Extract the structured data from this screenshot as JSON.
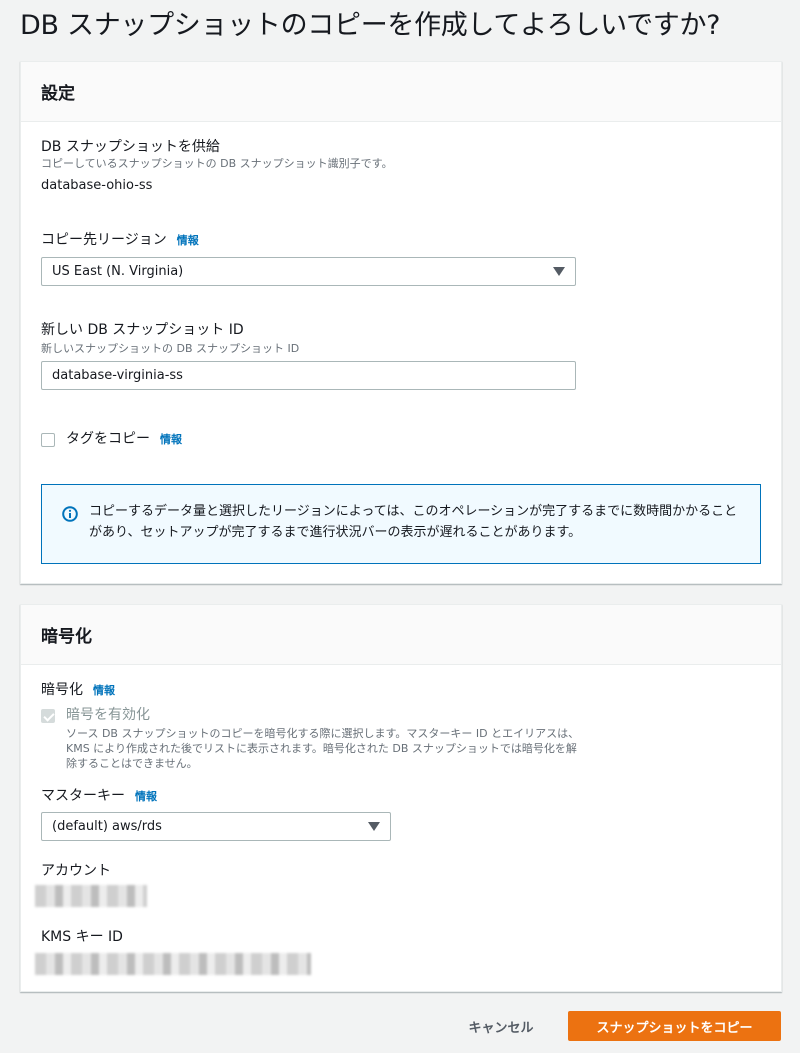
{
  "page": {
    "title": "DB スナップショットのコピーを作成してよろしいですか?"
  },
  "settings": {
    "header": "設定",
    "source_snapshot": {
      "label": "DB スナップショットを供給",
      "description": "コピーしているスナップショットの DB スナップショット識別子です。",
      "value": "database-ohio-ss"
    },
    "destination_region": {
      "label": "コピー先リージョン",
      "info": "情報",
      "selected": "US East (N. Virginia)"
    },
    "new_snapshot_id": {
      "label": "新しい DB スナップショット ID",
      "description": "新しいスナップショットの DB スナップショット ID",
      "value": "database-virginia-ss"
    },
    "copy_tags": {
      "label": "タグをコピー",
      "info": "情報",
      "checked": false
    },
    "alert": {
      "text": "コピーするデータ量と選択したリージョンによっては、このオペレーションが完了するまでに数時間かかることがあり、セットアップが完了するまで進行状況バーの表示が遅れることがあります。"
    }
  },
  "encryption": {
    "header": "暗号化",
    "encryption_field": {
      "label": "暗号化",
      "info": "情報"
    },
    "enable_encryption": {
      "label": "暗号を有効化",
      "description": "ソース DB スナップショットのコピーを暗号化する際に選択します。マスターキー ID とエイリアスは、KMS により作成された後でリストに表示されます。暗号化された DB スナップショットでは暗号化を解除することはできません。",
      "checked": true,
      "disabled": true
    },
    "master_key": {
      "label": "マスターキー",
      "info": "情報",
      "selected": "(default) aws/rds"
    },
    "account": {
      "label": "アカウント"
    },
    "kms_key_id": {
      "label": "KMS キー ID"
    }
  },
  "footer": {
    "cancel_label": "キャンセル",
    "copy_label": "スナップショットをコピー"
  },
  "colors": {
    "primary": "#ec7211",
    "link": "#0073bb",
    "alert_border": "#0073bb",
    "alert_bg": "#f1faff"
  }
}
